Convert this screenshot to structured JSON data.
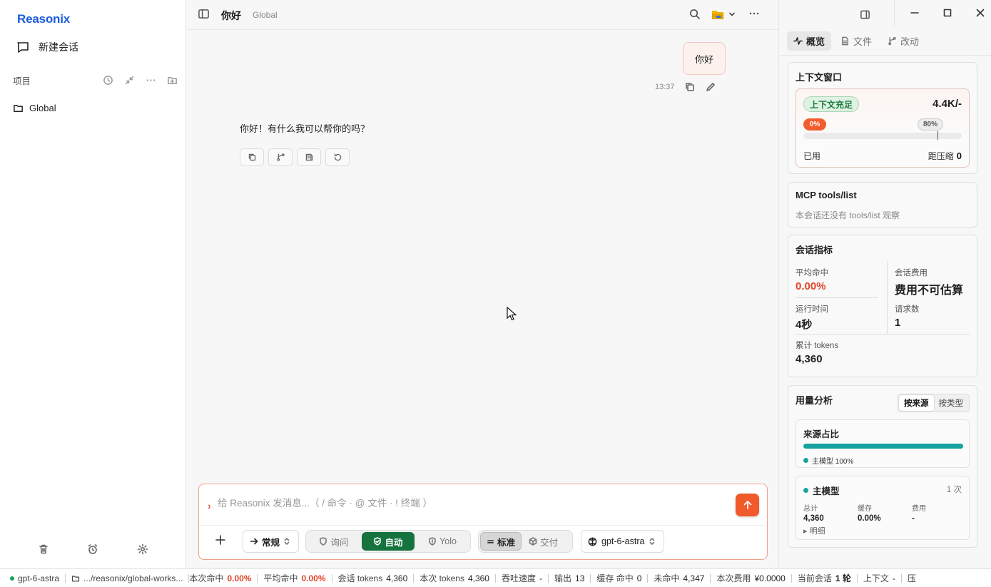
{
  "app": {
    "logo": "Reasonix"
  },
  "sidebar": {
    "new_chat": "新建会话",
    "projects_label": "项目",
    "projects": [
      {
        "name": "Global"
      }
    ]
  },
  "chat": {
    "title": "你好",
    "scope": "Global",
    "messages": [
      {
        "role": "user",
        "text": "你好",
        "time": "13:37"
      },
      {
        "role": "assistant",
        "text": "你好！有什么我可以帮你的吗？"
      }
    ]
  },
  "composer": {
    "placeholder": "给 Reasonix 发消息...（ / 命令 · @ 文件 · ! 终端 ）",
    "mode": "常规",
    "permissions": [
      "询问",
      "自动",
      "Yolo"
    ],
    "permission_active": "自动",
    "styles": [
      "标准",
      "交付"
    ],
    "style_active": "标准",
    "model": "gpt-6-astra"
  },
  "right_panel": {
    "tabs": [
      "概览",
      "文件",
      "改动"
    ],
    "active_tab": "概览",
    "context": {
      "title": "上下文窗口",
      "badge": "上下文充足",
      "value": "4.4K/-",
      "used_pct_label": "0%",
      "used_fraction": 0.0,
      "threshold_label": "80%",
      "threshold_fraction": 0.8,
      "used_label": "已用",
      "remain_label": "距压缩",
      "remain_value": "0"
    },
    "mcp": {
      "title": "MCP tools/list",
      "note": "本会话还没有 tools/list 观察"
    },
    "metrics": {
      "title": "会话指标",
      "avg_hit_label": "平均命中",
      "avg_hit_value": "0.00%",
      "cost_label": "会话费用",
      "cost_value": "费用不可估算",
      "runtime_label": "运行时间",
      "runtime_value": "4秒",
      "requests_label": "请求数",
      "requests_value": "1",
      "tokens_label": "累计 tokens",
      "tokens_value": "4,360"
    },
    "usage": {
      "title": "用量分析",
      "tabs": [
        "按来源",
        "按类型"
      ],
      "active_tab": "按来源",
      "source_title": "来源占比",
      "source_legend": "主模型 100%",
      "source_fraction": 1.0,
      "model_name": "主模型",
      "model_count": "1 次",
      "total_label": "总计",
      "total_value": "4,360",
      "cache_label": "缓存",
      "cache_value": "0.00%",
      "fee_label": "费用",
      "fee_value": "-",
      "detail_label": "明细"
    }
  },
  "statusbar": {
    "model": "gpt-6-astra",
    "path": ".../reasonix/global-works...",
    "items": [
      {
        "label": "本次命中",
        "value": "0.00%",
        "style": "red"
      },
      {
        "label": "平均命中",
        "value": "0.00%",
        "style": "red"
      },
      {
        "label": "会话 tokens",
        "value": "4,360",
        "style": ""
      },
      {
        "label": "本次 tokens",
        "value": "4,360",
        "style": ""
      },
      {
        "label": "吞吐速度",
        "value": "-",
        "style": ""
      },
      {
        "label": "输出",
        "value": "13",
        "style": ""
      },
      {
        "label": "缓存 命中",
        "value": "0",
        "style": ""
      },
      {
        "label": "未命中",
        "value": "4,347",
        "style": ""
      },
      {
        "label": "本次费用",
        "value": "¥0.0000",
        "style": ""
      },
      {
        "label": "当前会话",
        "value": "1 轮",
        "style": "bold"
      },
      {
        "label": "上下文",
        "value": "-",
        "style": ""
      }
    ],
    "trailing": "压"
  },
  "colors": {
    "accent": "#f15a2b",
    "brand": "#1a5bdc",
    "active_green": "#16733d",
    "teal": "#17a2a2"
  }
}
